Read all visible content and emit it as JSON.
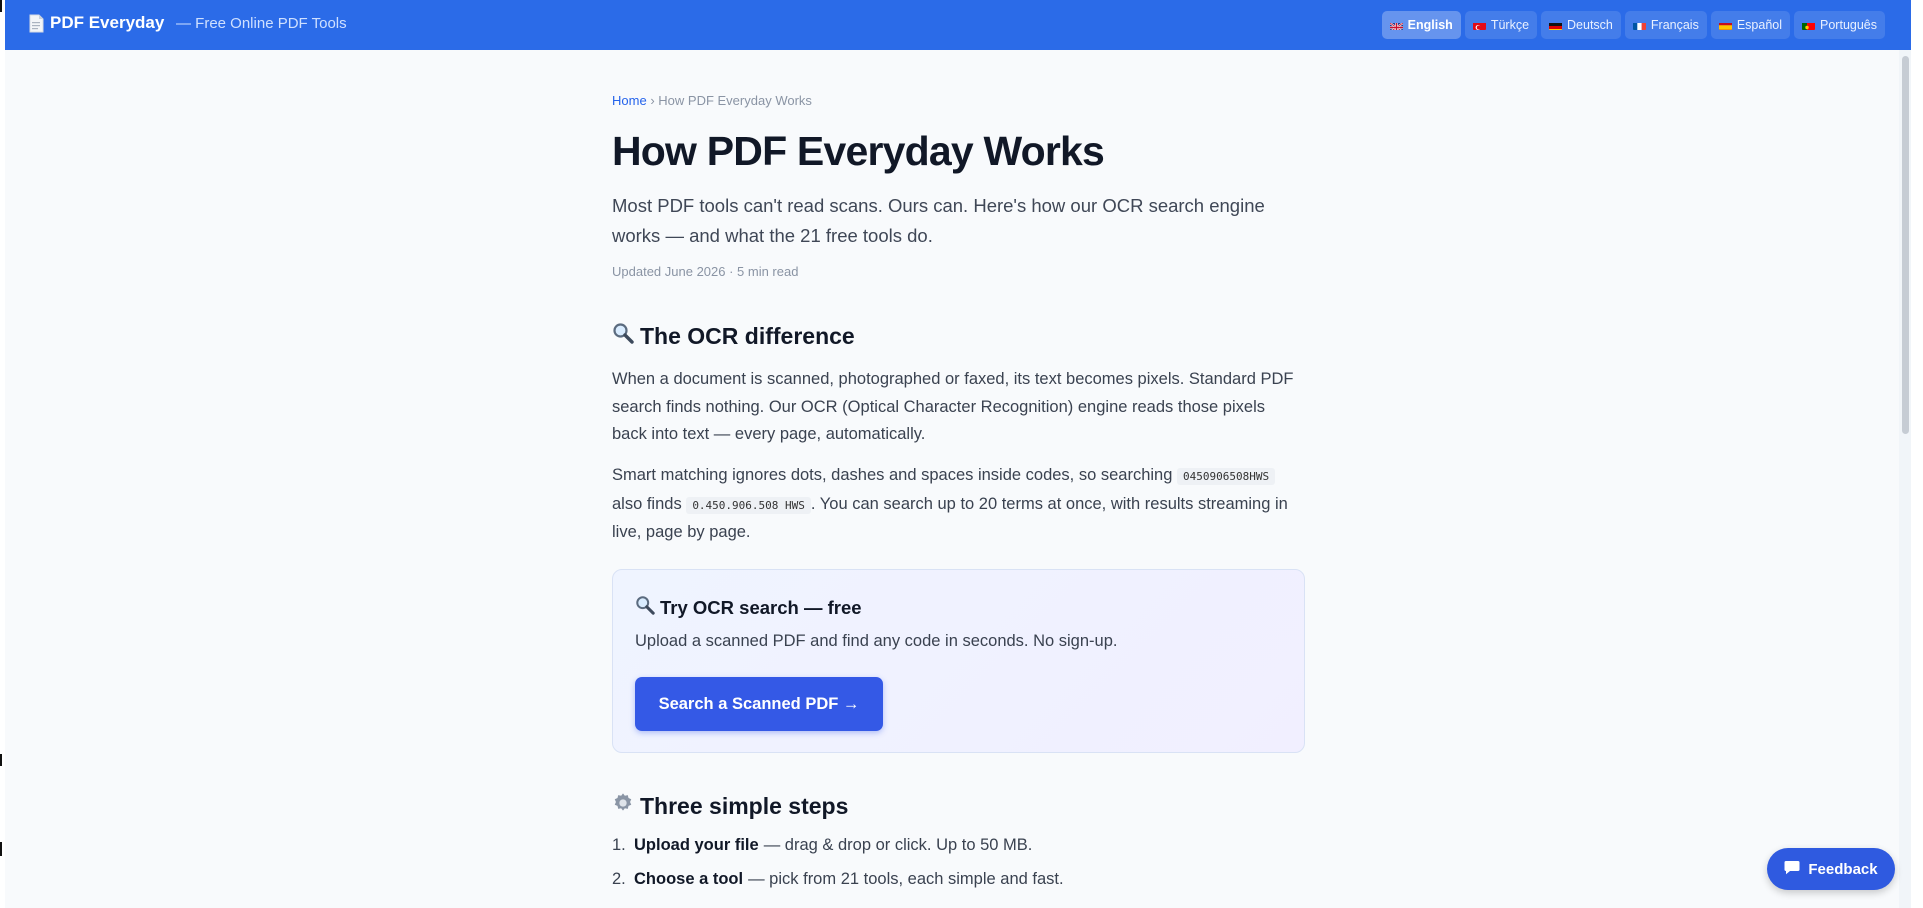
{
  "header": {
    "brand": "PDF Everyday",
    "tagline": "— Free Online PDF Tools",
    "languages": [
      {
        "label": "English",
        "flag": "uk-flag-icon",
        "active": true
      },
      {
        "label": "Türkçe",
        "flag": "turkey-flag-icon",
        "active": false
      },
      {
        "label": "Deutsch",
        "flag": "germany-flag-icon",
        "active": false
      },
      {
        "label": "Français",
        "flag": "france-flag-icon",
        "active": false
      },
      {
        "label": "Español",
        "flag": "spain-flag-icon",
        "active": false
      },
      {
        "label": "Português",
        "flag": "portugal-flag-icon",
        "active": false
      }
    ]
  },
  "breadcrumb": {
    "home": "Home",
    "separator": "›",
    "current": "How PDF Everyday Works"
  },
  "page": {
    "title": "How PDF Everyday Works",
    "lead": "Most PDF tools can't read scans. Ours can. Here's how our OCR search engine works — and what the 21 free tools do.",
    "meta": "Updated June 2026 · 5 min read"
  },
  "ocr_section": {
    "icon": "magnifier-icon",
    "heading": "The OCR difference",
    "para1": "When a document is scanned, photographed or faxed, its text becomes pixels. Standard PDF search finds nothing. Our OCR (Optical Character Recognition) engine reads those pixels back into text — every page, automatically.",
    "para2_a": "Smart matching ignores dots, dashes and spaces inside codes, so searching",
    "code1": "0450906508HWS",
    "para2_b": "also finds",
    "code2": "0.450.906.508 HWS",
    "para2_c": ". You can search up to 20 terms at once, with results streaming in live, page by page."
  },
  "cta": {
    "icon": "magnifier-icon",
    "title": "Try OCR search — free",
    "text": "Upload a scanned PDF and find any code in seconds. No sign-up.",
    "button": "Search a Scanned PDF →"
  },
  "steps_section": {
    "icon": "gear-icon",
    "heading": "Three simple steps",
    "steps": [
      {
        "num": "1.",
        "bold": "Upload your file",
        "text": "— drag & drop or click. Up to 50 MB."
      },
      {
        "num": "2.",
        "bold": "Choose a tool",
        "text": "— pick from 21 tools, each simple and fast."
      }
    ]
  },
  "feedback": {
    "label": "Feedback",
    "icon": "chat-icon"
  },
  "colors": {
    "header": "#2b6be8",
    "link": "#2563eb",
    "button": "#3459e6"
  }
}
